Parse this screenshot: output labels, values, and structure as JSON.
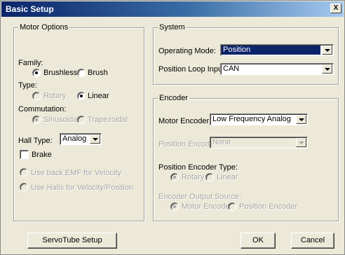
{
  "window": {
    "title": "Basic Setup",
    "close_label": "X"
  },
  "motor_options": {
    "legend": "Motor Options",
    "family": {
      "label": "Family:",
      "options": [
        "Brushless",
        "Brush"
      ],
      "selected": "Brushless"
    },
    "type": {
      "label": "Type:",
      "options": [
        "Rotary",
        "Linear"
      ],
      "selected": "Linear"
    },
    "commutation": {
      "label": "Commutation:",
      "options": [
        "Sinusoidal",
        "Trapezoidal"
      ],
      "selected": "Sinusoidal"
    },
    "hall_type": {
      "label": "Hall Type:",
      "value": "Analog"
    },
    "brake": {
      "label": "Brake",
      "checked": false
    },
    "velocity_options": [
      "Use back EMF for Velocity",
      "Use Halls for Velocity/Position"
    ]
  },
  "system": {
    "legend": "System",
    "operating_mode": {
      "label": "Operating Mode:",
      "value": "Position"
    },
    "position_loop_input": {
      "label": "Position Loop Input:",
      "value": "CAN"
    }
  },
  "encoder": {
    "legend": "Encoder",
    "motor_encoder": {
      "label": "Motor Encoder:",
      "value": "Low Frequency Analog"
    },
    "position_encoder": {
      "label": "Position Encoder:",
      "value": "None"
    },
    "position_encoder_type": {
      "label": "Position Encoder Type:",
      "options": [
        "Rotary",
        "Linear"
      ],
      "selected": "Rotary"
    },
    "output_source": {
      "label": "Encoder Output Source:",
      "options": [
        "Motor Encoder",
        "Position Encoder"
      ],
      "selected": "Motor Encoder"
    }
  },
  "buttons": {
    "servotube": "ServoTube Setup",
    "ok": "OK",
    "cancel": "Cancel"
  }
}
